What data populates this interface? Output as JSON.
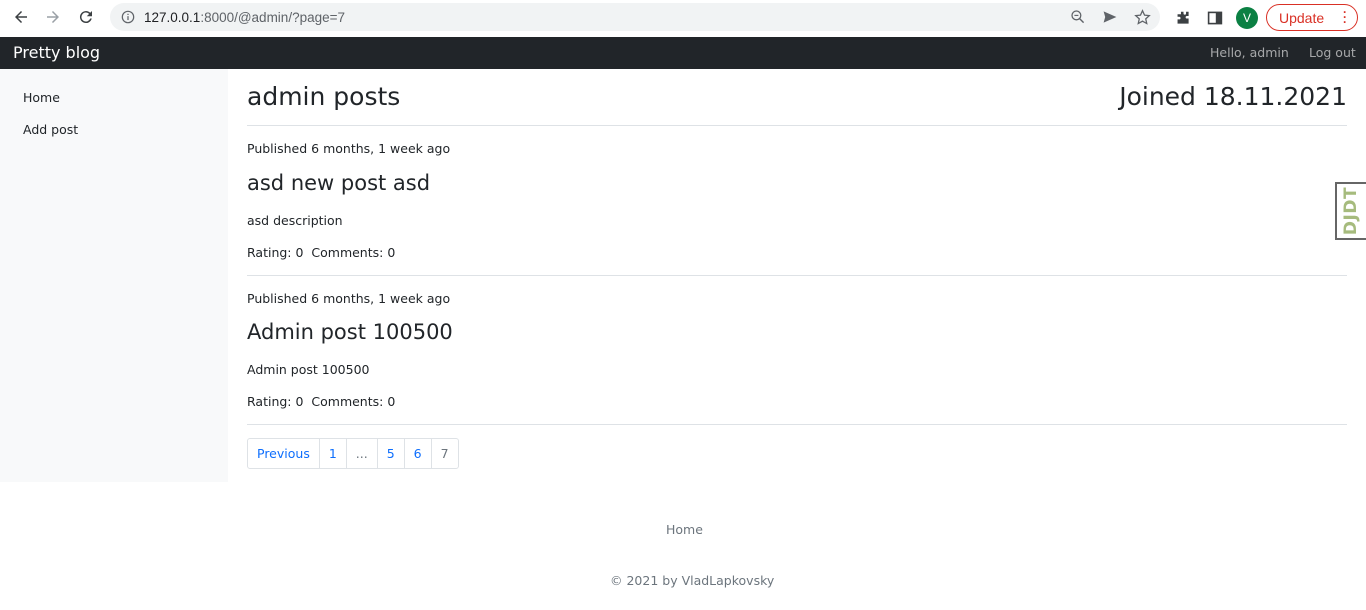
{
  "browser": {
    "url_host": "127.0.0.1",
    "url_rest": ":8000/@admin/?page=7",
    "avatar_letter": "V",
    "update_label": "Update"
  },
  "navbar": {
    "brand": "Pretty blog",
    "greeting": "Hello, admin",
    "logout": "Log out"
  },
  "sidebar": {
    "items": [
      {
        "label": "Home"
      },
      {
        "label": "Add post"
      }
    ]
  },
  "main": {
    "title": "admin posts",
    "joined": "Joined 18.11.2021",
    "posts": [
      {
        "published": "Published 6 months, 1 week ago",
        "title": "asd new post asd",
        "description": "asd description",
        "meta": "Rating: 0  Comments: 0"
      },
      {
        "published": "Published 6 months, 1 week ago",
        "title": "Admin post 100500",
        "description": "Admin post 100500",
        "meta": "Rating: 0  Comments: 0"
      }
    ],
    "pagination": [
      "Previous",
      "1",
      "...",
      "5",
      "6",
      "7"
    ]
  },
  "footer": {
    "link": "Home",
    "copyright": "© 2021 by VladLapkovsky"
  },
  "djdt": {
    "label": "DJDT"
  },
  "colors": {
    "navbar_bg": "#212529",
    "link_blue": "#0d6efd",
    "update_red": "#d93025",
    "avatar_green": "#0b8043",
    "djdt_green": "#a6bb7d"
  }
}
